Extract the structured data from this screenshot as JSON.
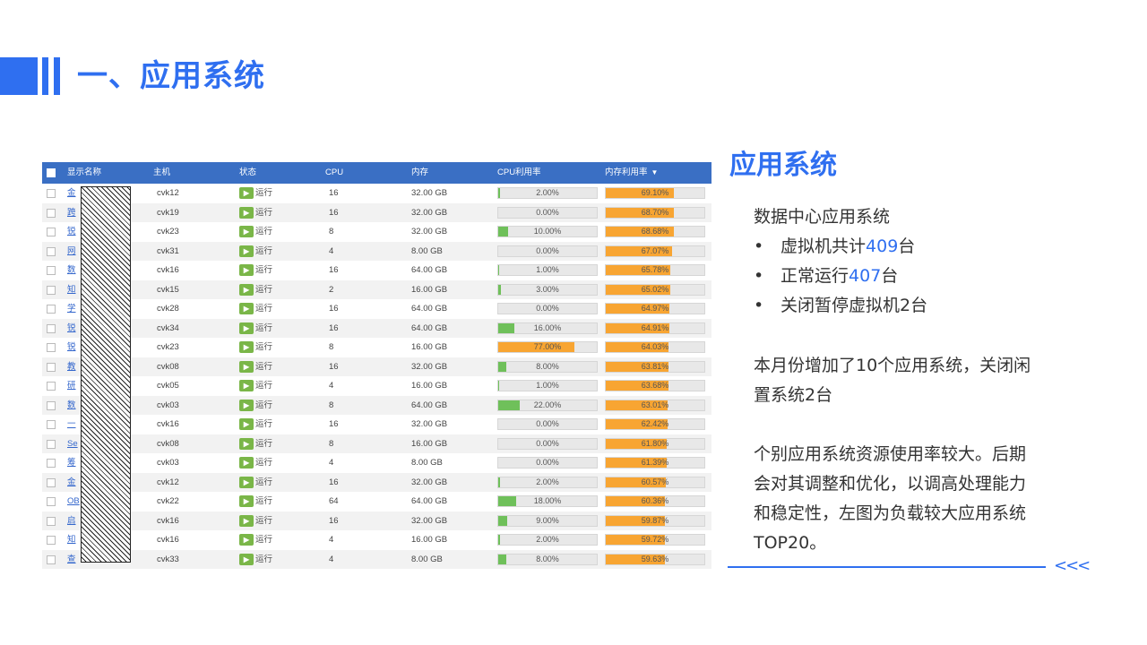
{
  "title": "一、应用系统",
  "table": {
    "headers": {
      "name": "显示名称",
      "host": "主机",
      "status": "状态",
      "cpu": "CPU",
      "mem": "内存",
      "cpu_util": "CPU利用率",
      "mem_util": "内存利用率"
    },
    "sort_icon": "sort-desc-icon",
    "rows": [
      {
        "name": "金",
        "host": "cvk12",
        "status": "运行",
        "cpu": "16",
        "mem": "32.00 GB",
        "cpu_util": "2.00%",
        "cpu_val": 2.0,
        "mem_util": "69.10%",
        "mem_val": 69.1
      },
      {
        "name": "跨",
        "host": "cvk19",
        "status": "运行",
        "cpu": "16",
        "mem": "32.00 GB",
        "cpu_util": "0.00%",
        "cpu_val": 0.0,
        "mem_util": "68.70%",
        "mem_val": 68.7
      },
      {
        "name": "锐",
        "host": "cvk23",
        "status": "运行",
        "cpu": "8",
        "mem": "32.00 GB",
        "cpu_util": "10.00%",
        "cpu_val": 10.0,
        "mem_util": "68.68%",
        "mem_val": 68.68
      },
      {
        "name": "网",
        "host": "cvk31",
        "status": "运行",
        "cpu": "4",
        "mem": "8.00 GB",
        "cpu_util": "0.00%",
        "cpu_val": 0.0,
        "mem_util": "67.07%",
        "mem_val": 67.07
      },
      {
        "name": "数",
        "host": "cvk16",
        "status": "运行",
        "cpu": "16",
        "mem": "64.00 GB",
        "cpu_util": "1.00%",
        "cpu_val": 1.0,
        "mem_util": "65.78%",
        "mem_val": 65.78
      },
      {
        "name": "知",
        "host": "cvk15",
        "status": "运行",
        "cpu": "2",
        "mem": "16.00 GB",
        "cpu_util": "3.00%",
        "cpu_val": 3.0,
        "mem_util": "65.02%",
        "mem_val": 65.02
      },
      {
        "name": "学",
        "host": "cvk28",
        "status": "运行",
        "cpu": "16",
        "mem": "64.00 GB",
        "cpu_util": "0.00%",
        "cpu_val": 0.0,
        "mem_util": "64.97%",
        "mem_val": 64.97
      },
      {
        "name": "锐",
        "host": "cvk34",
        "status": "运行",
        "cpu": "16",
        "mem": "64.00 GB",
        "cpu_util": "16.00%",
        "cpu_val": 16.0,
        "mem_util": "64.91%",
        "mem_val": 64.91
      },
      {
        "name": "锐",
        "host": "cvk23",
        "status": "运行",
        "cpu": "8",
        "mem": "16.00 GB",
        "cpu_util": "77.00%",
        "cpu_val": 77.0,
        "mem_util": "64.03%",
        "mem_val": 64.03
      },
      {
        "name": "教",
        "host": "cvk08",
        "status": "运行",
        "cpu": "16",
        "mem": "32.00 GB",
        "cpu_util": "8.00%",
        "cpu_val": 8.0,
        "mem_util": "63.81%",
        "mem_val": 63.81
      },
      {
        "name": "研",
        "host": "cvk05",
        "status": "运行",
        "cpu": "4",
        "mem": "16.00 GB",
        "cpu_util": "1.00%",
        "cpu_val": 1.0,
        "mem_util": "63.68%",
        "mem_val": 63.68
      },
      {
        "name": "数",
        "host": "cvk03",
        "status": "运行",
        "cpu": "8",
        "mem": "64.00 GB",
        "cpu_util": "22.00%",
        "cpu_val": 22.0,
        "mem_util": "63.01%",
        "mem_val": 63.01
      },
      {
        "name": "一",
        "host": "cvk16",
        "status": "运行",
        "cpu": "16",
        "mem": "32.00 GB",
        "cpu_util": "0.00%",
        "cpu_val": 0.0,
        "mem_util": "62.42%",
        "mem_val": 62.42
      },
      {
        "name": "Se",
        "host": "cvk08",
        "status": "运行",
        "cpu": "8",
        "mem": "16.00 GB",
        "cpu_util": "0.00%",
        "cpu_val": 0.0,
        "mem_util": "61.80%",
        "mem_val": 61.8
      },
      {
        "name": "筹",
        "host": "cvk03",
        "status": "运行",
        "cpu": "4",
        "mem": "8.00 GB",
        "cpu_util": "0.00%",
        "cpu_val": 0.0,
        "mem_util": "61.39%",
        "mem_val": 61.39
      },
      {
        "name": "金",
        "host": "cvk12",
        "status": "运行",
        "cpu": "16",
        "mem": "32.00 GB",
        "cpu_util": "2.00%",
        "cpu_val": 2.0,
        "mem_util": "60.57%",
        "mem_val": 60.57
      },
      {
        "name": "OB",
        "host": "cvk22",
        "status": "运行",
        "cpu": "64",
        "mem": "64.00 GB",
        "cpu_util": "18.00%",
        "cpu_val": 18.0,
        "mem_util": "60.36%",
        "mem_val": 60.36
      },
      {
        "name": "启",
        "host": "cvk16",
        "status": "运行",
        "cpu": "16",
        "mem": "32.00 GB",
        "cpu_util": "9.00%",
        "cpu_val": 9.0,
        "mem_util": "59.87%",
        "mem_val": 59.87
      },
      {
        "name": "知",
        "host": "cvk16",
        "status": "运行",
        "cpu": "4",
        "mem": "16.00 GB",
        "cpu_util": "2.00%",
        "cpu_val": 2.0,
        "mem_util": "59.72%",
        "mem_val": 59.72
      },
      {
        "name": "查",
        "host": "cvk33",
        "status": "运行",
        "cpu": "4",
        "mem": "8.00 GB",
        "cpu_util": "8.00%",
        "cpu_val": 8.0,
        "mem_util": "59.63%",
        "mem_val": 59.63
      }
    ]
  },
  "panel": {
    "title": "应用系统",
    "intro": "数据中心应用系统",
    "bullets": [
      {
        "pre": "虚拟机共计",
        "num": "409",
        "post": "台"
      },
      {
        "pre": "正常运行",
        "num": "407",
        "post": "台"
      },
      {
        "pre": "关闭暂停虚拟机2台",
        "num": "",
        "post": ""
      }
    ],
    "para1": [
      "本月份增加了10个应用系统，关闭闲",
      "置系统2台"
    ],
    "para2": [
      "个别应用系统资源使用率较大。后期",
      "会对其调整和优化，以调高处理能力",
      "和稳定性，左图为负载较大应用系统",
      "TOP20。"
    ],
    "bullet_char": "•",
    "arrows": "<<<"
  },
  "colors": {
    "accent": "#2f6ff0",
    "header": "#3a6fc4",
    "cpu_bar": "#6fc05a",
    "mem_bar": "#f8a532"
  }
}
